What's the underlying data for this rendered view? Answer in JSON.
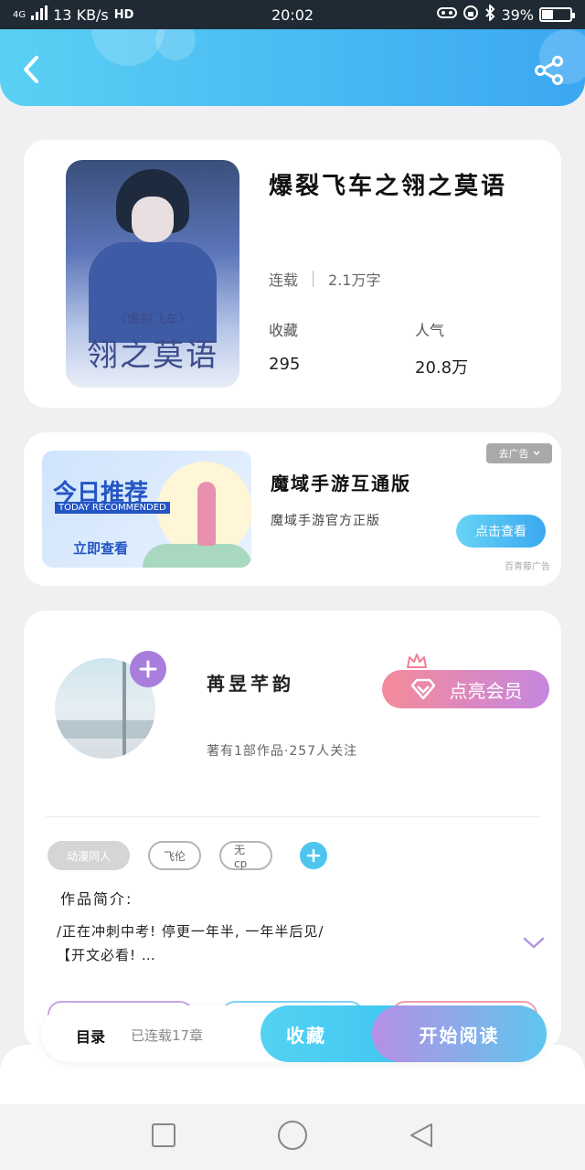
{
  "status_bar": {
    "network": "4G",
    "speed": "13 KB/s",
    "hd": "HD",
    "time": "20:02",
    "battery": "39%",
    "battery_level": 0.39
  },
  "book": {
    "title": "爆裂飞车之翎之莫语",
    "status": "连载",
    "word_count": "2.1万字",
    "favorites_label": "收藏",
    "favorites_value": "295",
    "popularity_label": "人气",
    "popularity_value": "20.8万",
    "cover": {
      "subtitle": "《爆裂飞车》",
      "title": "翎之莫语"
    }
  },
  "ad": {
    "banner": {
      "headline": "今日推荐",
      "headline_en": "TODAY RECOMMENDED",
      "button": "立即查看"
    },
    "title": "魔域手游互通版",
    "subtitle": "魔域手游官方正版",
    "remove_label": "去广告",
    "cta_label": "点击查看",
    "source": "百青藤广告"
  },
  "author": {
    "name": "苒昱芊韵",
    "stats": "著有1部作品·257人关注",
    "vip_label": "点亮会员"
  },
  "tags": [
    "动漫同人",
    "飞伦",
    "无cp"
  ],
  "intro": {
    "label": "作品简介:",
    "line1": "/正在冲刺中考! 停更一年半, 一年半后见/",
    "line2": "【开文必看! …"
  },
  "action_bar": {
    "toc_label": "目录",
    "chapter_count": "已连载17章",
    "favorite_label": "收藏",
    "read_label": "开始阅读"
  },
  "colors": {
    "header_start": "#5ad0f3",
    "header_end": "#3ba7f2",
    "vip_start": "#f58a9a",
    "vip_end": "#c587e0",
    "accent_blue": "#4dc5ef",
    "accent_purple": "#a87ddc"
  },
  "icons": {
    "back": "back-arrow-icon",
    "share": "share-icon",
    "add": "plus-icon",
    "vip": "diamond-icon",
    "crown": "crown-icon",
    "expand": "chevron-down-icon",
    "nav_recent": "square-icon",
    "nav_home": "circle-icon",
    "nav_back": "triangle-back-icon"
  }
}
